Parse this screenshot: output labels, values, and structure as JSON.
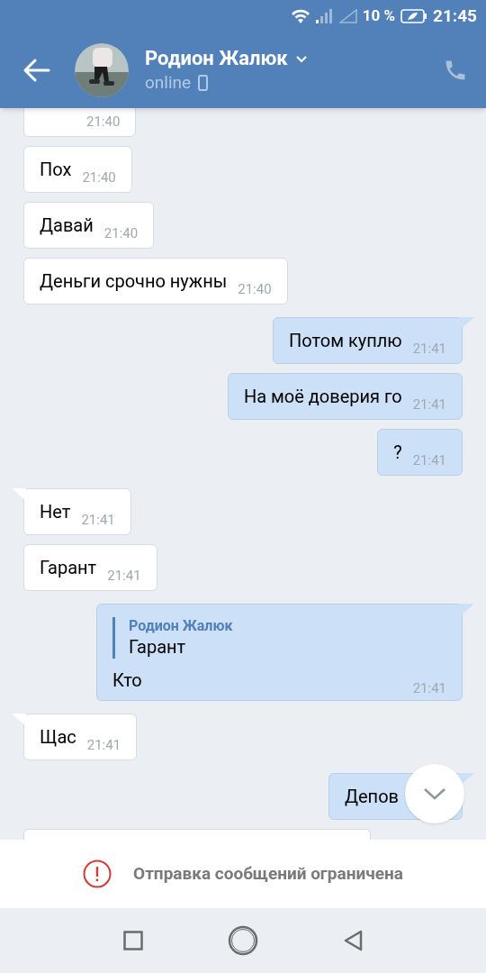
{
  "status_bar": {
    "battery": "10 %",
    "time": "21:45"
  },
  "header": {
    "name": "Родион Жалюк",
    "status": "online"
  },
  "messages": [
    {
      "kind": "incoming",
      "tail": false,
      "time": "21:40"
    },
    {
      "kind": "incoming",
      "tail": false,
      "text": "Пох",
      "time": "21:40"
    },
    {
      "kind": "incoming",
      "tail": false,
      "text": "Давай",
      "time": "21:40"
    },
    {
      "kind": "incoming",
      "tail": false,
      "text": "Деньги срочно нужны",
      "time": "21:40"
    },
    {
      "kind": "outgoing",
      "tail": true,
      "text": "Потом куплю",
      "time": "21:41"
    },
    {
      "kind": "outgoing",
      "tail": false,
      "text": "На моё доверия го",
      "time": "21:41"
    },
    {
      "kind": "outgoing",
      "tail": false,
      "text": "?",
      "time": "21:41"
    },
    {
      "kind": "incoming",
      "tail": true,
      "text": "Нет",
      "time": "21:41"
    },
    {
      "kind": "incoming",
      "tail": false,
      "text": "Гарант",
      "time": "21:41"
    },
    {
      "kind": "outgoing",
      "tail": true,
      "reply": {
        "author": "Родион Жалюк",
        "text": "Гарант"
      },
      "text": "Кто",
      "time": "21:41"
    },
    {
      "kind": "incoming",
      "tail": true,
      "text": "Щас",
      "time": "21:41"
    },
    {
      "kind": "outgoing",
      "tail": true,
      "text": "Депов"
    },
    {
      "kind": "incoming",
      "tail": false
    }
  ],
  "notice": "Отправка сообщений ограничена"
}
